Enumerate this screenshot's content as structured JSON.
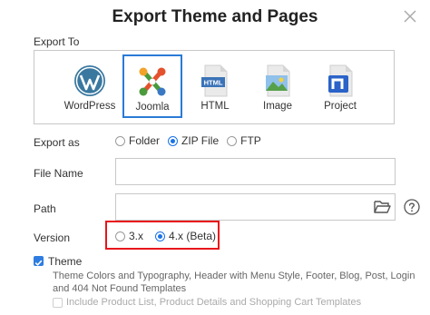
{
  "dialog": {
    "title": "Export Theme and Pages"
  },
  "export_to": {
    "label": "Export To",
    "targets": [
      {
        "label": "WordPress",
        "icon": "wordpress-icon",
        "selected": false
      },
      {
        "label": "Joomla",
        "icon": "joomla-icon",
        "selected": true
      },
      {
        "label": "HTML",
        "icon": "html-file-icon",
        "selected": false
      },
      {
        "label": "Image",
        "icon": "image-file-icon",
        "selected": false
      },
      {
        "label": "Project",
        "icon": "project-file-icon",
        "selected": false
      }
    ]
  },
  "export_as": {
    "label": "Export as",
    "options": [
      {
        "label": "Folder",
        "selected": false
      },
      {
        "label": "ZIP File",
        "selected": true
      },
      {
        "label": "FTP",
        "selected": false
      }
    ]
  },
  "file_name": {
    "label": "File Name",
    "value": ""
  },
  "path": {
    "label": "Path",
    "value": "",
    "icon": "folder-open-icon"
  },
  "help": {
    "icon": "help-icon"
  },
  "version": {
    "label": "Version",
    "options": [
      {
        "label": "3.x",
        "selected": false
      },
      {
        "label": "4.x (Beta)",
        "selected": true
      }
    ],
    "highlight_color": "#e8141b"
  },
  "theme": {
    "label": "Theme",
    "checked": true,
    "description": "Theme Colors and Typography, Header with Menu Style, Footer, Blog, Post, Login and 404 Not Found Templates",
    "include_products": {
      "label": "Include Product List, Product Details and Shopping Cart Templates",
      "checked": false
    }
  },
  "colors": {
    "accent": "#1a73e8",
    "selected_border": "#2a7ad6"
  }
}
